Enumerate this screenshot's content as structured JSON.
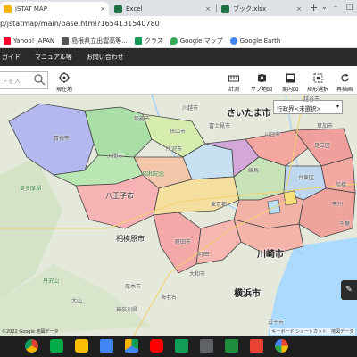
{
  "browser": {
    "tabs": [
      {
        "title": "jSTAT MAP",
        "active": true,
        "fav_color": "#f4b400"
      },
      {
        "title": "Excel",
        "active": false,
        "fav_color": "#1e7145"
      },
      {
        "title": "ブック.xlsx",
        "active": false,
        "fav_color": "#1e7145"
      }
    ],
    "tab_close": "×",
    "new_tab": "+",
    "window_controls": [
      "⌄",
      "–",
      "□"
    ],
    "url_path": "p/jstatmap/main/base.html?1654131540780"
  },
  "bookmarks": [
    {
      "label": "Yahoo! JAPAN",
      "color": "#ff0033"
    },
    {
      "label": "島根県立出雲高等...",
      "color": "#555555"
    },
    {
      "label": "クラス",
      "color": "#0f9d58"
    },
    {
      "label": "Google マップ",
      "color": "#34a853"
    },
    {
      "label": "Google Earth",
      "color": "#4285f4"
    }
  ],
  "menubar": {
    "items": [
      "ガイド",
      "マニュアル等",
      "お問い合わせ"
    ]
  },
  "toolbar": {
    "search_placeholder": "ドを入",
    "current_location": "現在地",
    "buttons": [
      {
        "label": "計測",
        "icon": "ruler-icon"
      },
      {
        "label": "サブ地図",
        "icon": "submap-icon"
      },
      {
        "label": "案内図",
        "icon": "guide-map-icon"
      },
      {
        "label": "矩形選択",
        "icon": "rect-select-icon"
      },
      {
        "label": "再描画",
        "icon": "redraw-icon"
      }
    ]
  },
  "map": {
    "pref_select": {
      "value": "行政界<未選択>",
      "arrow": "▾"
    },
    "labels": {
      "saitama": "さいたま市",
      "koshigaya": "越谷市",
      "soka": "草加市",
      "adachi": "足立区",
      "hachioji": "八王子市",
      "sagamihara": "相模原市",
      "kawasaki": "川崎市",
      "yokohama": "横浜市",
      "ome": "青梅市",
      "hanno": "飯能市",
      "tokorozawa": "所沢市",
      "kawagoe": "川越市",
      "kawaguchi": "川口市",
      "iruma": "入間市",
      "sayama": "狭山市",
      "fujimi": "富士見市",
      "yamato": "大和市",
      "machida": "町田市",
      "zushi": "逗子市",
      "atsugi": "厚木市",
      "kanagawa": "神奈川県",
      "tanzawa": "丹沢山",
      "okutama": "奥多摩湖",
      "kasumigaura": "東京都",
      "ebina": "海老名",
      "ichikawa": "市川",
      "taito": "台東区",
      "nerima": "練馬",
      "machida2": "町田",
      "chiba": "千葉",
      "funabashi": "船橋",
      "showa": "昭和記念",
      "ooyama": "大山"
    },
    "footer_left": "©2022 Google 地図データ",
    "footer_right": "キーボード ショートカット　地図データ",
    "edit_icon": "✎"
  },
  "taskbar": {
    "apps": [
      {
        "name": "chrome-icon",
        "color": "#db4437"
      },
      {
        "name": "meet-icon",
        "color": "#00ac47"
      },
      {
        "name": "keep-icon",
        "color": "#fbbc04"
      },
      {
        "name": "docs-icon",
        "color": "#4285f4"
      },
      {
        "name": "drive-icon",
        "color": "#0f9d58"
      },
      {
        "name": "youtube-icon",
        "color": "#ff0000"
      },
      {
        "name": "sheets-icon",
        "color": "#0f9d58"
      },
      {
        "name": "files-icon",
        "color": "#5f6368"
      },
      {
        "name": "classroom-icon",
        "color": "#1e8e3e"
      },
      {
        "name": "gmail-icon",
        "color": "#ea4335"
      },
      {
        "name": "photos-icon",
        "color": "#fbbc04"
      }
    ]
  }
}
